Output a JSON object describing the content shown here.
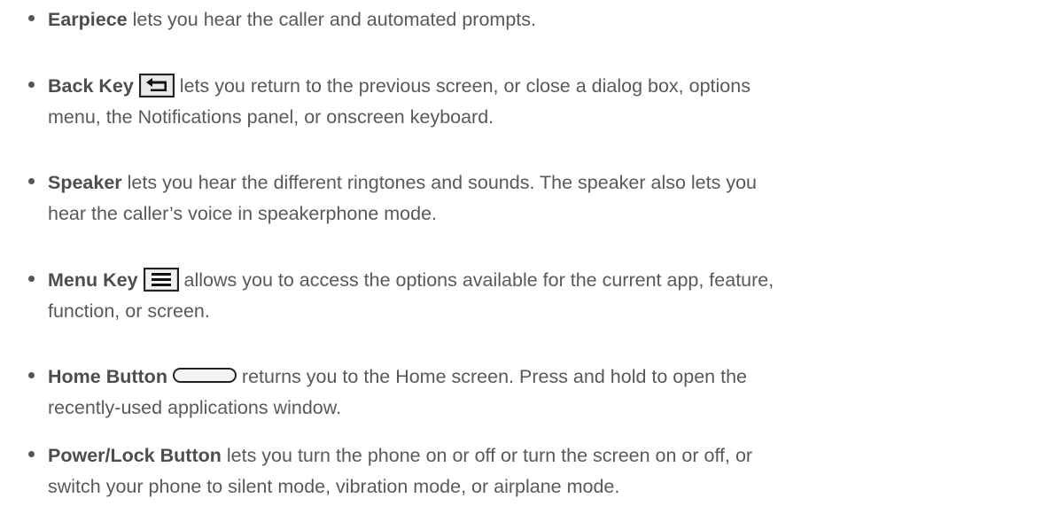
{
  "items": [
    {
      "term": "Earpiece",
      "line1": " lets you hear the caller and automated prompts.",
      "line2": ""
    },
    {
      "term": "Back Key",
      "icon": "back-arrow-icon",
      "line1": " lets you return to the previous screen, or close a dialog box, options",
      "line2": "menu, the Notifications panel, or onscreen keyboard."
    },
    {
      "term": "Speaker",
      "line1": " lets you hear the different ringtones and sounds. The speaker also lets you",
      "line2": "hear the caller’s voice in speakerphone mode."
    },
    {
      "term": "Menu Key",
      "icon": "menu-lines-icon",
      "line1": " allows you to access the options available for the current app, feature,",
      "line2": "function, or screen."
    },
    {
      "term": "Home Button",
      "icon": "home-pill-icon",
      "line1": " returns you to the Home screen. Press and hold to open the",
      "line2": "recently-used applications window."
    },
    {
      "term": "Power/Lock Button",
      "line1": " lets you turn the phone on or off or turn the screen on or off, or",
      "line2": "switch your phone to silent mode, vibration mode, or airplane mode."
    }
  ],
  "colors": {
    "text": "#595959",
    "term": "#4d4d4d",
    "icon_border": "#222222"
  }
}
